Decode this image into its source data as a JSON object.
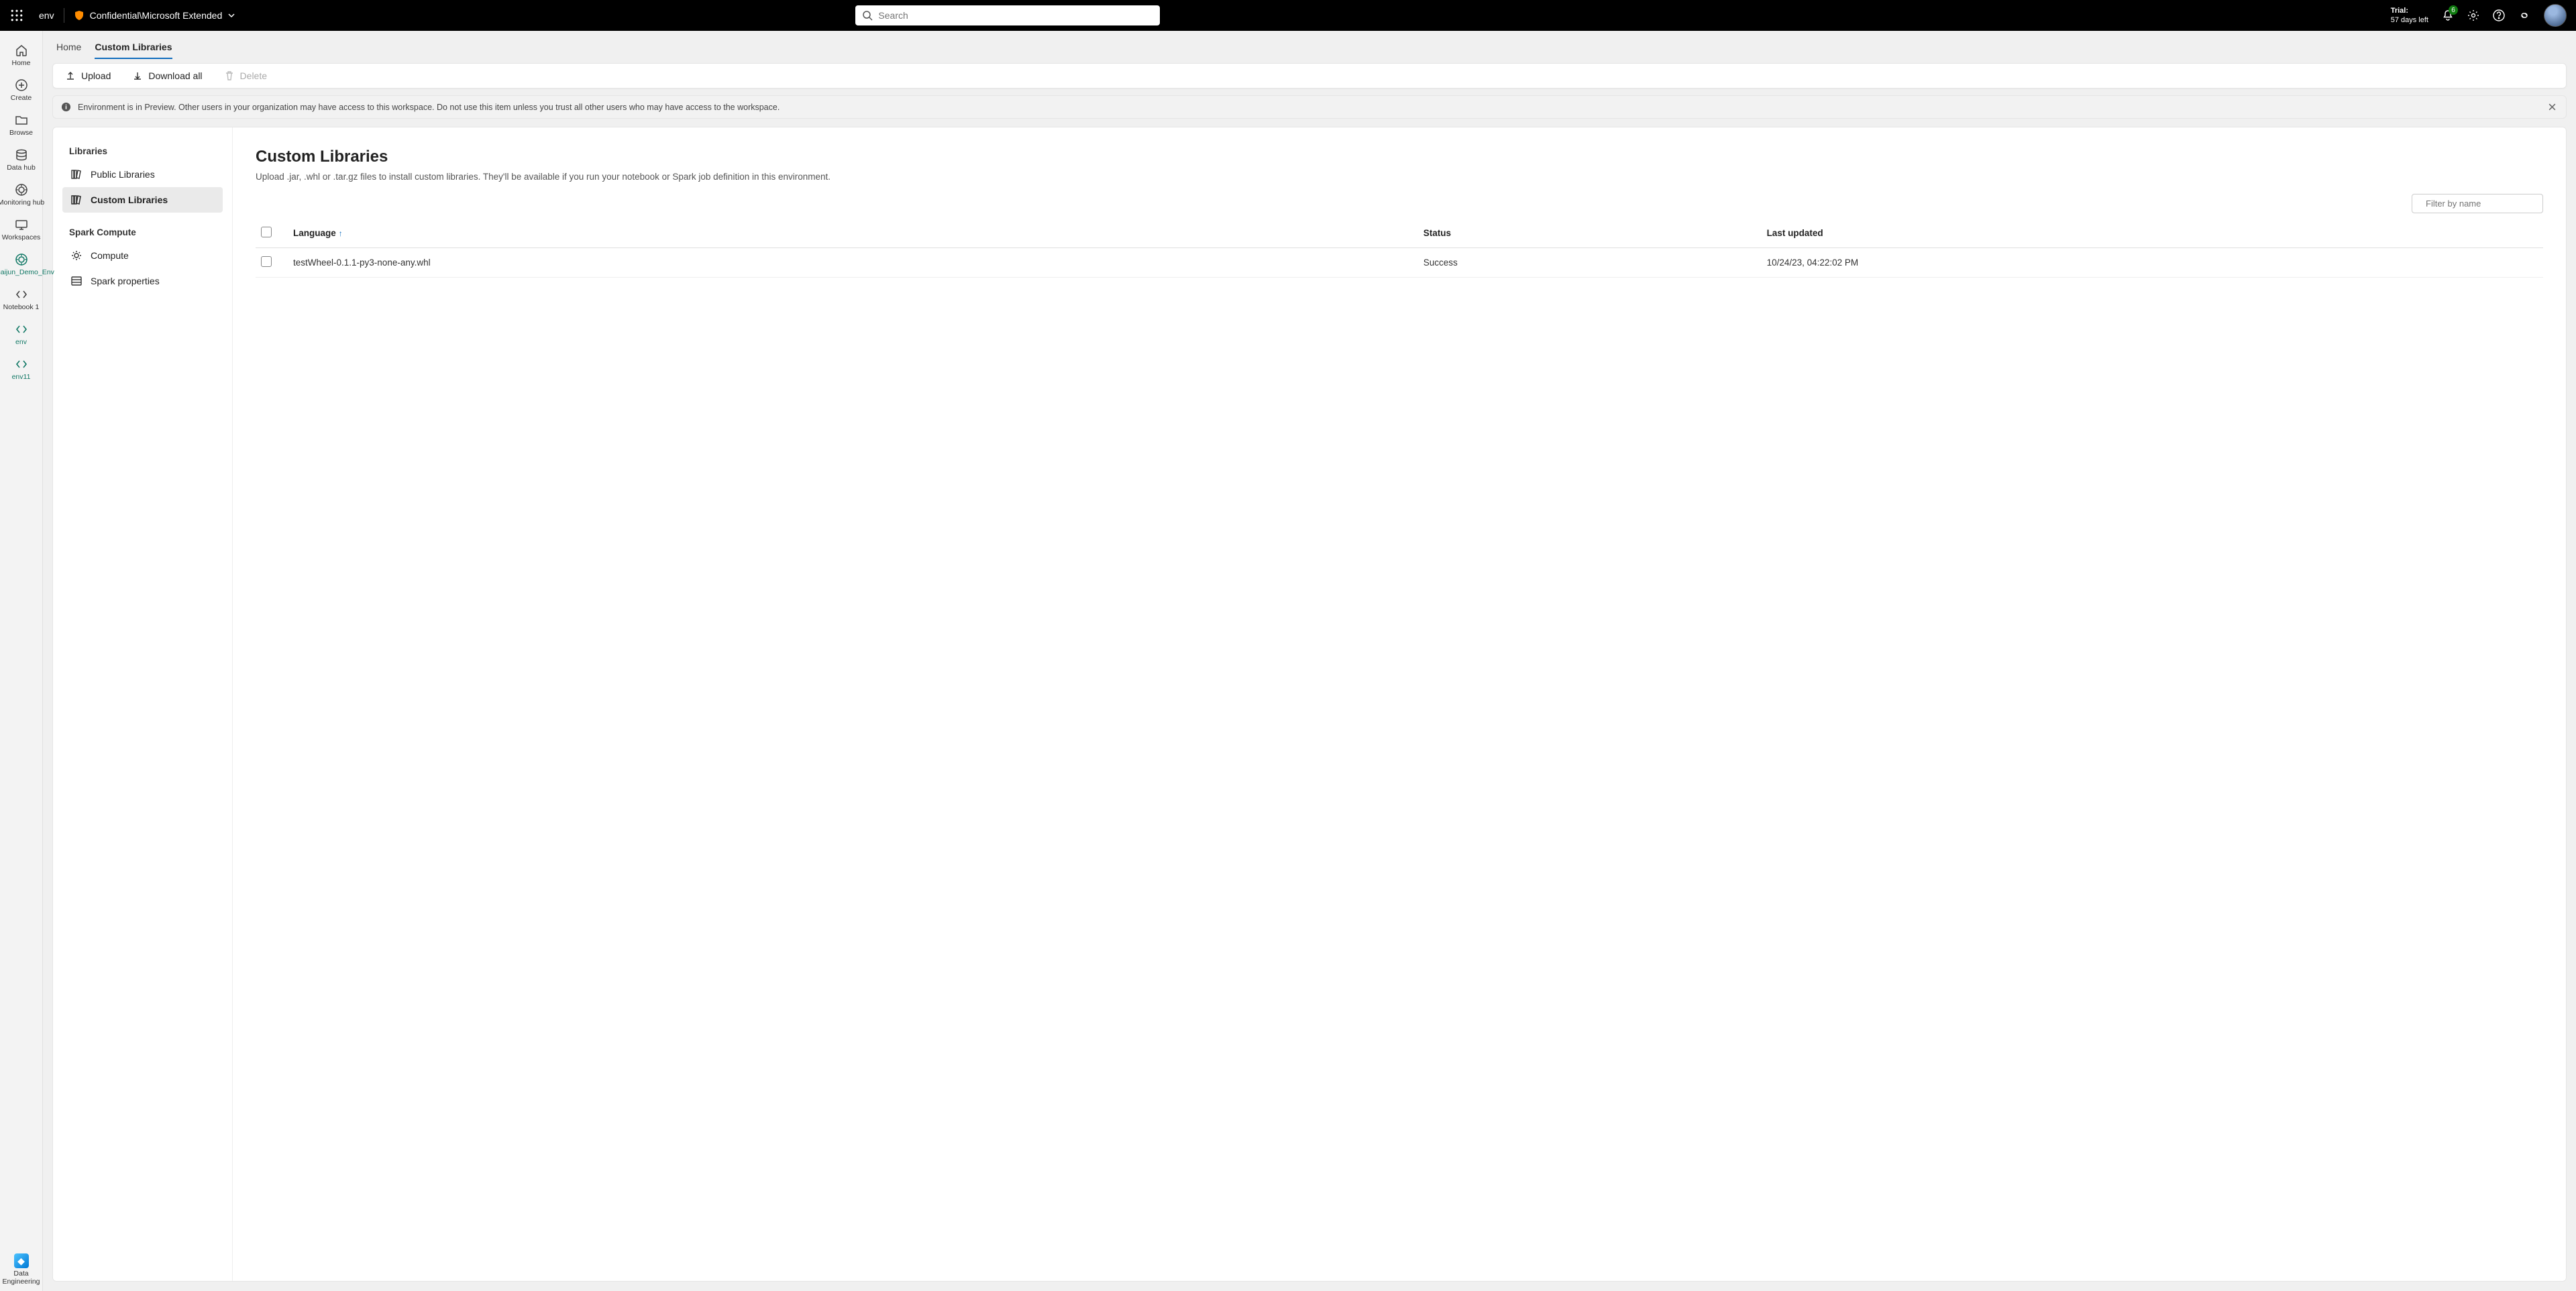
{
  "topbar": {
    "env_label": "env",
    "sensitivity": "Confidential\\Microsoft Extended",
    "search_placeholder": "Search",
    "trial_label": "Trial:",
    "trial_days": "57 days left",
    "notification_count": "6"
  },
  "rail": {
    "items": [
      {
        "label": "Home",
        "icon": "home"
      },
      {
        "label": "Create",
        "icon": "plus-circle"
      },
      {
        "label": "Browse",
        "icon": "folder"
      },
      {
        "label": "Data hub",
        "icon": "database"
      },
      {
        "label": "Monitoring hub",
        "icon": "target"
      },
      {
        "label": "Workspaces",
        "icon": "monitor"
      },
      {
        "label": "Shuaijun_Demo_Env",
        "icon": "target",
        "accent": true
      },
      {
        "label": "Notebook 1",
        "icon": "code-brackets"
      },
      {
        "label": "env",
        "icon": "code-brackets",
        "accent": true,
        "active": true
      },
      {
        "label": "env11",
        "icon": "code-brackets",
        "accent": true
      }
    ],
    "footer": {
      "label": "Data Engineering",
      "icon": "data-eng"
    }
  },
  "tabs": [
    {
      "label": "Home",
      "active": false
    },
    {
      "label": "Custom Libraries",
      "active": true
    }
  ],
  "toolbar": {
    "upload": "Upload",
    "download_all": "Download all",
    "delete": "Delete"
  },
  "notice": "Environment is in Preview. Other users in your organization may have access to this workspace. Do not use this item unless you trust all other users who may have access to the workspace.",
  "sidenav": {
    "group_libraries": "Libraries",
    "public_libraries": "Public Libraries",
    "custom_libraries": "Custom Libraries",
    "group_spark": "Spark Compute",
    "compute": "Compute",
    "spark_properties": "Spark properties"
  },
  "panel": {
    "title": "Custom Libraries",
    "desc": "Upload .jar, .whl or .tar.gz files to install custom libraries. They'll be available if you run your notebook or Spark job definition in this environment.",
    "filter_placeholder": "Filter by name",
    "columns": {
      "language": "Language",
      "status": "Status",
      "last_updated": "Last updated"
    },
    "rows": [
      {
        "name": "testWheel-0.1.1-py3-none-any.whl",
        "status": "Success",
        "last_updated": "10/24/23, 04:22:02 PM"
      }
    ]
  }
}
